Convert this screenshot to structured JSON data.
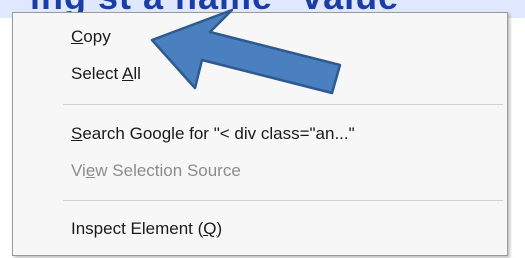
{
  "background_text": "ing st a name\"  value",
  "context_menu": {
    "items": [
      {
        "id": "copy",
        "parts": [
          {
            "t": "",
            "u": false
          },
          {
            "t": "C",
            "u": true
          },
          {
            "t": "opy",
            "u": false
          }
        ],
        "disabled": false
      },
      {
        "id": "select-all",
        "parts": [
          {
            "t": "Select ",
            "u": false
          },
          {
            "t": "A",
            "u": true
          },
          {
            "t": "ll",
            "u": false
          }
        ],
        "disabled": false
      },
      {
        "id": "search-google",
        "parts": [
          {
            "t": "",
            "u": false
          },
          {
            "t": "S",
            "u": true
          },
          {
            "t": "earch Google for \"< div class=\"an...\"",
            "u": false
          }
        ],
        "disabled": false
      },
      {
        "id": "view-selection-source",
        "parts": [
          {
            "t": "Vi",
            "u": false
          },
          {
            "t": "e",
            "u": true
          },
          {
            "t": "w Selection Source",
            "u": false
          }
        ],
        "disabled": true
      },
      {
        "id": "inspect-element",
        "parts": [
          {
            "t": "Inspect Element (",
            "u": false
          },
          {
            "t": "Q",
            "u": true
          },
          {
            "t": ")",
            "u": false
          }
        ],
        "disabled": false
      }
    ]
  },
  "annotation": {
    "type": "arrow",
    "points_to": "copy",
    "fill_color": "#4a7fc0",
    "stroke_color": "#2e5a8f"
  }
}
